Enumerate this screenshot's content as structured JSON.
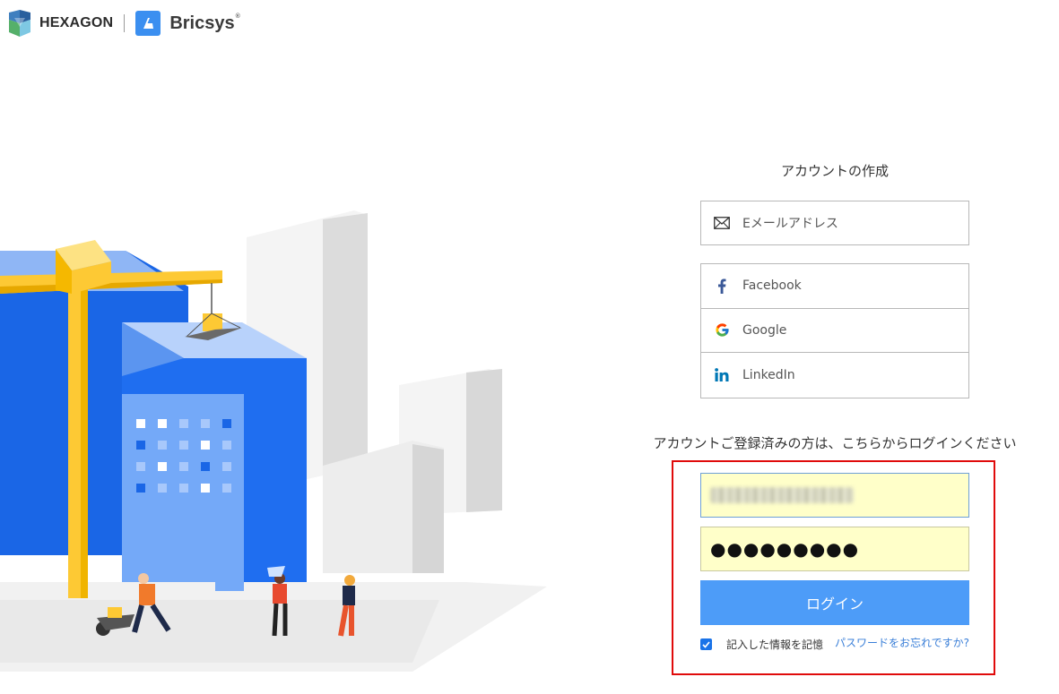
{
  "header": {
    "brand_left": "HEXAGON",
    "brand_right": "Bricsys",
    "brand_right_tm": "®"
  },
  "signup": {
    "title": "アカウントの作成",
    "email_label": "Eメールアドレス",
    "social": [
      {
        "label": "Facebook",
        "icon": "facebook-icon"
      },
      {
        "label": "Google",
        "icon": "google-icon"
      },
      {
        "label": "LinkedIn",
        "icon": "linkedin-icon"
      }
    ]
  },
  "login": {
    "heading": "アカウントご登録済みの方は、こちらからログインください",
    "password_mask": "●●●●●●●●●",
    "button_label": "ログイン",
    "remember_label": "記入した情報を記憶",
    "remember_checked": true,
    "forgot_label": "パスワードをお忘れですか?"
  },
  "colors": {
    "accent": "#4d9cf8",
    "highlight_border": "#e00b0b",
    "autofill": "#ffffc9",
    "link": "#3a7fd8"
  }
}
